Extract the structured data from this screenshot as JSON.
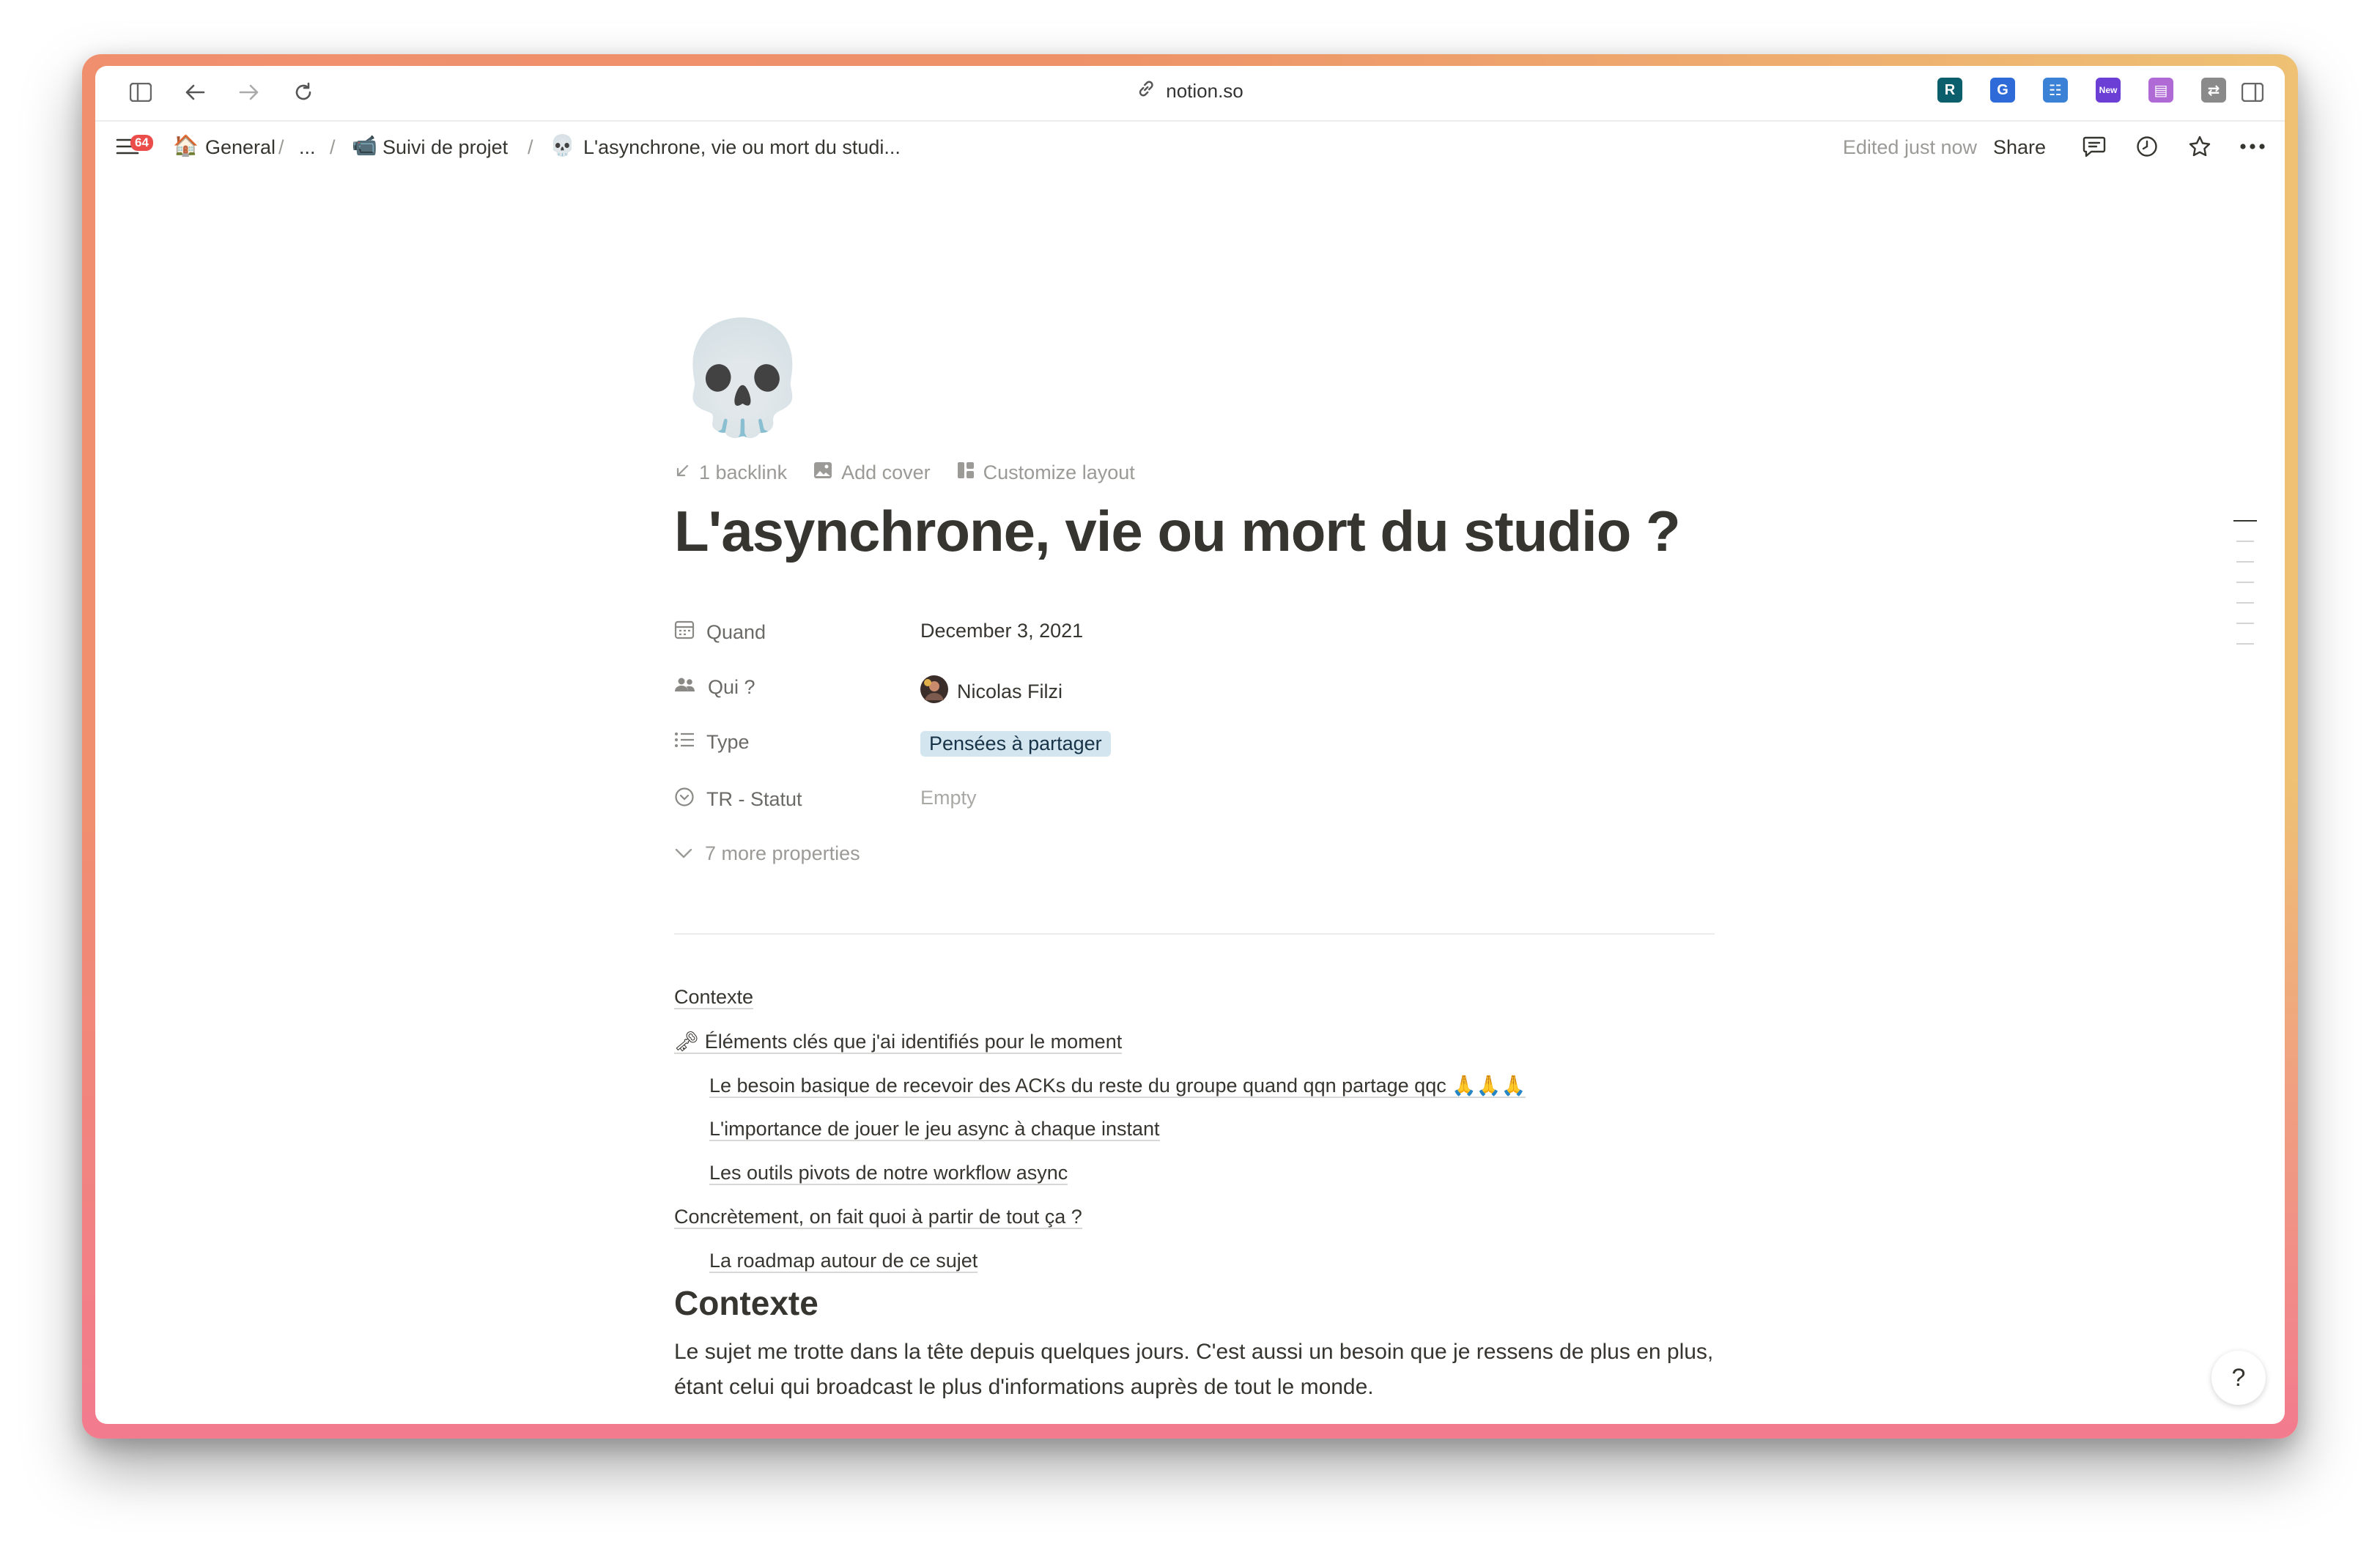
{
  "browser": {
    "url": "notion.so",
    "extensions": [
      {
        "name": "ext-readwise",
        "glyph": "R",
        "color": "#0b5e6b"
      },
      {
        "name": "ext-grammarly",
        "glyph": "G",
        "color": "#2f6bd8"
      },
      {
        "name": "ext-table",
        "glyph": "☷",
        "color": "#3b82d6"
      },
      {
        "name": "ext-new",
        "glyph": "New",
        "color": "#6b3fd6"
      },
      {
        "name": "ext-notebook",
        "glyph": "▤",
        "color": "#b06ad6"
      },
      {
        "name": "ext-toggle",
        "glyph": "⇄",
        "color": "#8a8a8a"
      }
    ]
  },
  "navbar": {
    "badge_count": "64",
    "breadcrumb": {
      "workspace": "General",
      "ellipsis": "...",
      "parent": "Suivi de projet",
      "current": "L'asynchrone, vie ou mort du studi..."
    },
    "edited": "Edited just now",
    "share": "Share"
  },
  "page": {
    "icon": "💀",
    "backlink": "1 backlink",
    "add_cover": "Add cover",
    "customize_layout": "Customize layout",
    "title": "L'asynchrone, vie ou mort du studio ?"
  },
  "properties": {
    "quand": {
      "label": "Quand",
      "value": "December 3, 2021"
    },
    "qui": {
      "label": "Qui ?",
      "value": "Nicolas Filzi"
    },
    "type": {
      "label": "Type",
      "value": "Pensées à partager",
      "tag_color": "#d3e5ef"
    },
    "statut": {
      "label": "TR - Statut",
      "value": "Empty"
    },
    "more": "7 more properties"
  },
  "toc": [
    {
      "text": "Contexte",
      "indent": 0
    },
    {
      "text": "🗝 Éléments clés que j'ai identifiés pour le moment",
      "indent": 0
    },
    {
      "text": "Le besoin basique de recevoir des ACKs du reste du groupe quand qqn partage qqc 🙏🙏🙏",
      "indent": 1
    },
    {
      "text": "L'importance de jouer le jeu async à chaque instant",
      "indent": 1
    },
    {
      "text": "Les outils pivots de notre workflow async",
      "indent": 1
    },
    {
      "text": "Concrètement, on fait quoi à partir de tout ça ?",
      "indent": 0
    },
    {
      "text": "La roadmap autour de ce sujet",
      "indent": 1
    }
  ],
  "body": {
    "heading": "Contexte",
    "paragraph": "Le sujet me trotte dans la tête depuis quelques jours. C'est aussi un besoin que je ressens de plus en plus, étant celui qui broadcast le plus d'informations auprès de tout le monde."
  },
  "help_glyph": "?"
}
